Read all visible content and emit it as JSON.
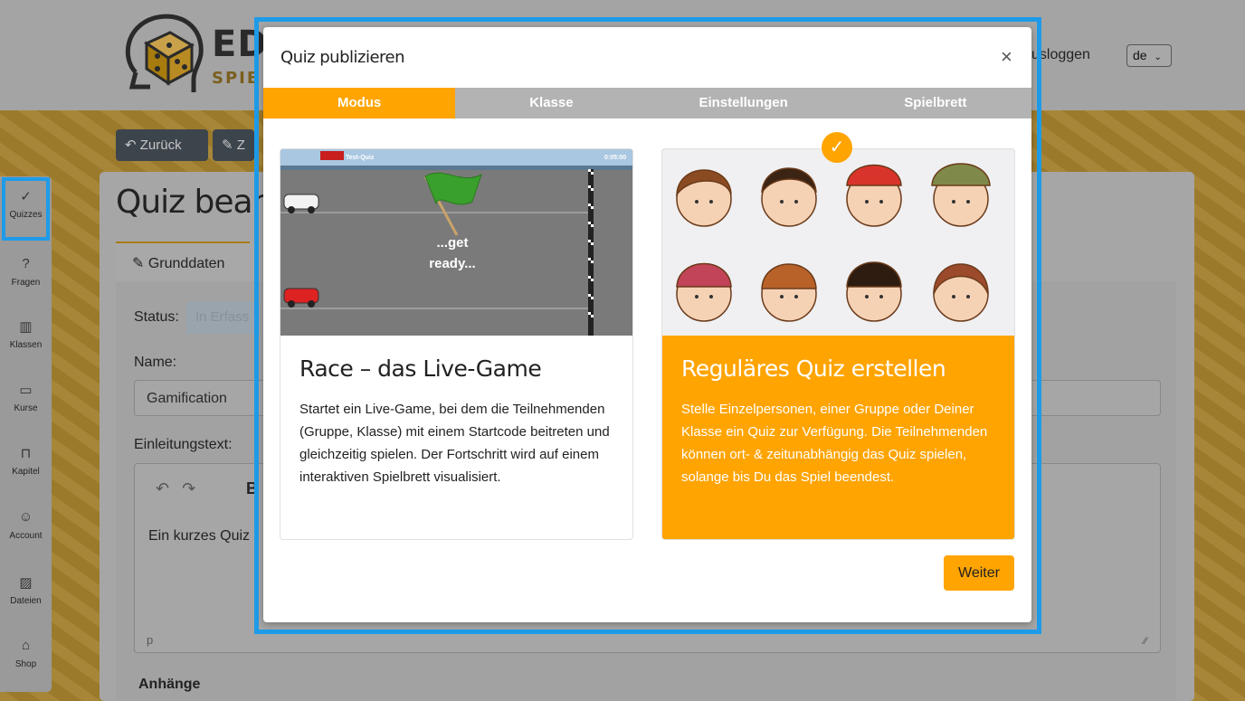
{
  "header": {
    "logo_text": "ED",
    "logo_sub": "SPIE",
    "logout_label": "usloggen",
    "language": "de"
  },
  "toolbar": {
    "back_label": "Zurück",
    "edit_label": "Z"
  },
  "sidebar": {
    "items": [
      {
        "label": "Quizzes",
        "icon": "check-icon"
      },
      {
        "label": "Fragen",
        "icon": "question-icon"
      },
      {
        "label": "Klassen",
        "icon": "books-icon"
      },
      {
        "label": "Kurse",
        "icon": "briefcase-icon"
      },
      {
        "label": "Kapitel",
        "icon": "bookmark-icon"
      },
      {
        "label": "Account",
        "icon": "user-icon"
      },
      {
        "label": "Dateien",
        "icon": "image-icon"
      },
      {
        "label": "Shop",
        "icon": "shop-icon"
      }
    ]
  },
  "main": {
    "title": "Quiz bearb",
    "tab_label": "Grunddaten",
    "status_label": "Status:",
    "status_value": "In Erfass",
    "name_label": "Name:",
    "name_value": "Gamification",
    "intro_label": "Einleitungstext:",
    "intro_value": "Ein kurzes Quiz",
    "editor_path": "p",
    "attachments_label": "Anhänge"
  },
  "modal": {
    "title": "Quiz publizieren",
    "close_label": "×",
    "tabs": [
      {
        "label": "Modus",
        "active": true
      },
      {
        "label": "Klasse",
        "active": false
      },
      {
        "label": "Einstellungen",
        "active": false
      },
      {
        "label": "Spielbrett",
        "active": false
      }
    ],
    "cards": [
      {
        "heading": "Race – das Live-Game",
        "body": "Startet ein Live-Game, bei dem die Teilnehmenden (Gruppe, Klasse) mit einem Startcode beitreten und gleichzeitig spielen. Der Fortschritt wird auf einem interaktiven Spielbrett visualisiert.",
        "image_text_1": "...get",
        "image_text_2": "ready...",
        "image_board_title": "Test-Quiz",
        "image_timer": "0:05:00",
        "selected": false
      },
      {
        "heading": "Reguläres Quiz erstellen",
        "body": "Stelle Einzelpersonen, einer Gruppe oder Deiner Klasse ein Quiz zur Verfügung. Die Teilnehmenden können ort- & zeitunabhängig das Quiz spielen, solange bis Du das Spiel beendest.",
        "selected": true
      }
    ],
    "next_label": "Weiter"
  },
  "colors": {
    "accent": "#ffa400",
    "highlight_frame": "#1e9be8",
    "tab_inactive": "#b3b3b3"
  }
}
